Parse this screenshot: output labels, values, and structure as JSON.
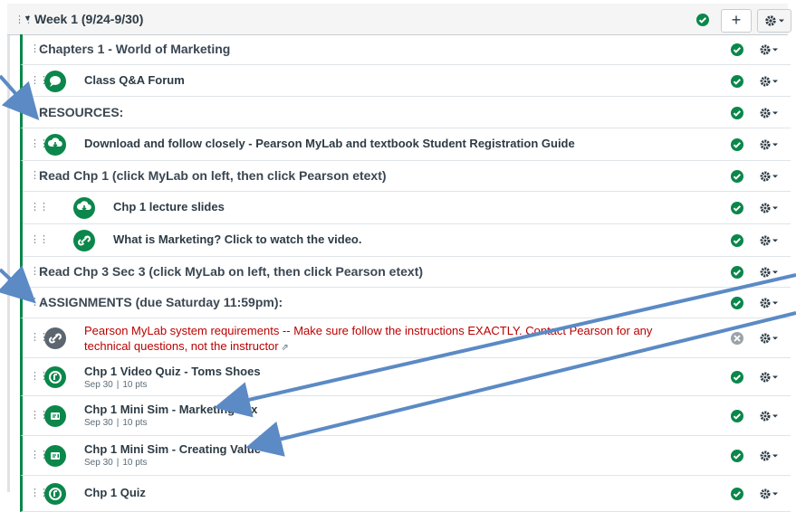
{
  "module": {
    "title": "Week 1 (9/24-9/30)",
    "add_label": "+"
  },
  "items": [
    {
      "title": "Chapters 1 - World of Marketing",
      "kind": "header",
      "icon": ""
    },
    {
      "title": "Class Q&A Forum",
      "kind": "item",
      "icon": "discussion-icon"
    },
    {
      "title": "RESOURCES:",
      "kind": "header",
      "icon": ""
    },
    {
      "title": "Download and follow closely - Pearson MyLab and textbook Student Registration Guide",
      "kind": "item",
      "icon": "download-icon"
    },
    {
      "title": "Read Chp 1 (click MyLab on left, then click Pearson etext)",
      "kind": "header",
      "icon": ""
    },
    {
      "title": "Chp 1 lecture slides",
      "kind": "indent-item",
      "icon": "download-icon"
    },
    {
      "title": "What is Marketing? Click to watch the video.",
      "kind": "indent-item",
      "icon": "link-icon"
    },
    {
      "title": "Read Chp 3 Sec 3 (click MyLab on left, then click Pearson etext)",
      "kind": "header",
      "icon": ""
    },
    {
      "title": "ASSIGNMENTS (due Saturday 11:59pm):",
      "kind": "header",
      "icon": ""
    },
    {
      "title": "Pearson MyLab system requirements -- Make sure follow the instructions EXACTLY. Contact Pearson for any technical questions, not the instructor",
      "kind": "external",
      "icon": "link-icon"
    },
    {
      "title": "Chp 1 Video Quiz - Toms Shoes",
      "kind": "assignment",
      "icon": "quiz-icon",
      "due": "Sep 30",
      "points": "10 pts"
    },
    {
      "title": "Chp 1 Mini Sim - Marketing Mix",
      "kind": "assignment",
      "icon": "assignment-icon",
      "due": "Sep 30",
      "points": "10 pts"
    },
    {
      "title": "Chp 1 Mini Sim - Creating Value",
      "kind": "assignment",
      "icon": "assignment-icon",
      "due": "Sep 30",
      "points": "10 pts"
    },
    {
      "title": "Chp 1 Quiz",
      "kind": "assignment",
      "icon": "quiz-icon"
    }
  ],
  "meta_separator": "|",
  "colors": {
    "published": "#0b874b",
    "unpublished": "#5b6670",
    "external": "#bb0000",
    "arrow": "#5b8ac5"
  }
}
